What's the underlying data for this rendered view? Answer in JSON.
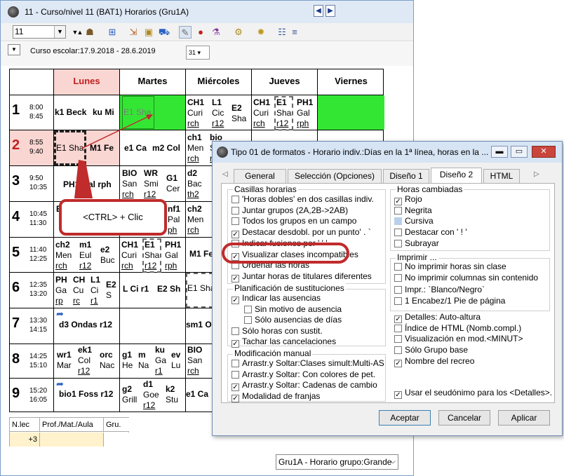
{
  "window": {
    "title": "11 - Curso/nivel 11 (BAT1)  Horarios (Gru1A)",
    "class_selector": "11",
    "school_year": "Curso escolar:17.9.2018 - 28.6.2019",
    "calendar_icon_label": "31"
  },
  "toolbar_icons": [
    "down-arrow-icon",
    "up-arrow-icon",
    "people-icon",
    "plus-grid-icon",
    "export-icon",
    "lock-icon",
    "car-icon",
    "pencil-icon",
    "pin-icon",
    "flask-icon",
    "settings-icon",
    "gear-icon",
    "people-icon",
    "list-menu-icon"
  ],
  "days": [
    "Lunes",
    "Martes",
    "Miércoles",
    "Jueves",
    "Viernes"
  ],
  "periods": [
    {
      "num": "1",
      "start": "8:00",
      "end": "8:45"
    },
    {
      "num": "2",
      "start": "8:55",
      "end": "9:40"
    },
    {
      "num": "3",
      "start": "9:50",
      "end": "10:35"
    },
    {
      "num": "4",
      "start": "10:45",
      "end": "11:30"
    },
    {
      "num": "5",
      "start": "11:40",
      "end": "12:25"
    },
    {
      "num": "6",
      "start": "12:35",
      "end": "13:20"
    },
    {
      "num": "7",
      "start": "13:30",
      "end": "14:15"
    },
    {
      "num": "8",
      "start": "14:25",
      "end": "15:10"
    },
    {
      "num": "9",
      "start": "15:20",
      "end": "16:05"
    }
  ],
  "cells": {
    "p1_lunes_a": "k1 Beck",
    "p1_lunes_b": "ku Mi",
    "p1_martes": "E1 Sha",
    "p1_mie_a": [
      "CH1",
      "Curi",
      "rch"
    ],
    "p1_mie_b": [
      "L1",
      "Cic",
      "r12"
    ],
    "p1_mie_c": [
      "E2",
      "Sha"
    ],
    "p1_jue_a": [
      "CH1",
      "Curi",
      "rch"
    ],
    "p1_jue_b": [
      "E1",
      "Sha",
      "r12"
    ],
    "p1_jue_c": [
      "PH1",
      "Gal",
      "rph"
    ],
    "p2_lunes_a": "E1 Sha",
    "p2_lunes_b": "M1 Fe",
    "p2_martes_a": "e1 Ca",
    "p2_martes_b": "m2 Col",
    "p2_mie_a": [
      "ch1",
      "Men",
      "rch"
    ],
    "p2_mie_b": [
      "bio",
      "S",
      "r"
    ],
    "p3_lunes": "PH1 Gal rph",
    "p3_martes_a": [
      "BIO",
      "San",
      "rch"
    ],
    "p3_martes_b": [
      "WR",
      "Smi",
      "r12"
    ],
    "p3_martes_c": [
      "G1",
      "Cer"
    ],
    "p3_mie_a": [
      "d2",
      "Bac",
      "th2"
    ],
    "p4_lunes": [
      "E"
    ],
    "p4_martes_a": [
      "nf1",
      "Pal",
      "ph"
    ],
    "p4_mie_a": [
      "ch2",
      "Men",
      "rch"
    ],
    "p5_lunes_a": [
      "ch2",
      "Men",
      "rch"
    ],
    "p5_lunes_b": [
      "m1",
      "Eul",
      "r12"
    ],
    "p5_lunes_c": [
      "e2",
      "Buc"
    ],
    "p5_martes_a": [
      "CH1",
      "Curi",
      "rch"
    ],
    "p5_martes_b": [
      "E1",
      "Sha",
      "r12"
    ],
    "p5_martes_c": [
      "PH1",
      "Gal",
      "rph"
    ],
    "p5_mie": "M1 Fe",
    "p6_lunes_a": [
      "PH",
      "Ga",
      "rp"
    ],
    "p6_lunes_b": [
      "CH",
      "Cu",
      "rc"
    ],
    "p6_lunes_c": [
      "L1",
      "Ci",
      "r1"
    ],
    "p6_lunes_d": [
      "E2",
      "S"
    ],
    "p6_martes_a": "L Ci r1",
    "p6_martes_b": "E2 Sh",
    "p6_mie": "E1 Sha",
    "p7_lunes": "d3 Ondas r12",
    "p7_mie": "sm1 O",
    "p8_lunes_a": [
      "wr1",
      "Mar"
    ],
    "p8_lunes_b": [
      "ek1",
      "Col",
      "r12"
    ],
    "p8_lunes_c": [
      "orc",
      "Nac"
    ],
    "p8_martes_a": [
      "g1",
      "He"
    ],
    "p8_martes_b": [
      "m",
      "Na"
    ],
    "p8_martes_c": [
      "ku",
      "Ga",
      "r1"
    ],
    "p8_martes_d": [
      "ev",
      "Lu"
    ],
    "p8_mie": [
      "BIO",
      "San",
      "rch"
    ],
    "p9_lunes": "bio1 Foss r12",
    "p9_martes_a": [
      "g2",
      "Grill"
    ],
    "p9_martes_b": [
      "d1",
      "Goe",
      "r12"
    ],
    "p9_martes_c": [
      "k2",
      "Stu"
    ],
    "p9_mie": "e1 Ca"
  },
  "bottom_panel": {
    "headers": [
      "N.lec",
      "Prof./Mat./Aula",
      "Gru."
    ],
    "row": [
      "+3",
      "",
      ""
    ]
  },
  "group_selector": "Gru1A - Horario grupo:Grande",
  "callout": "<CTRL> + Clic",
  "dialog": {
    "title": "Tipo 01 de formatos - Horario indiv.:Días en la 1ª línea, horas en la ...",
    "tabs": [
      "General",
      "Selección (Opciones)",
      "Diseño 1",
      "Diseño 2",
      "HTML"
    ],
    "active_tab": "Diseño 2",
    "casillas": {
      "label": "Casillas horarias",
      "items": [
        {
          "label": "'Horas dobles' en dos casillas indiv.",
          "checked": false
        },
        {
          "label": "Juntar grupos (2A,2B->2AB)",
          "checked": false
        },
        {
          "label": "Todos los grupos en un campo",
          "checked": false
        },
        {
          "label": "Destacar desdobl. por un punto' . `",
          "checked": true
        },
        {
          "label": "Indicar fusiones por  ' ' '",
          "checked": false
        },
        {
          "label": "Visualizar clases incompatibles",
          "checked": true
        },
        {
          "label": "Ordenar las horas",
          "checked": false
        },
        {
          "label": "Juntar horas de titulares diferentes",
          "checked": true
        }
      ]
    },
    "planificacion": {
      "label": "Planificación de sustituciones",
      "items": [
        {
          "label": "Indicar las ausencias",
          "checked": true
        },
        {
          "label": "Sin motivo de ausencia",
          "checked": false
        },
        {
          "label": "Sólo ausencias de días",
          "checked": false
        },
        {
          "label": "Sólo horas con sustit.",
          "checked": false
        },
        {
          "label": "Tachar las cancelaciones",
          "checked": true
        }
      ]
    },
    "modificacion": {
      "label": "Modificación manual",
      "items": [
        {
          "label": "Arrastr.y Soltar:Clases simult:Multi-AS",
          "checked": false
        },
        {
          "label": "Arrastr.y Soltar: Con colores de pet.",
          "checked": false
        },
        {
          "label": "Arrastr.y Soltar: Cadenas de cambio",
          "checked": true
        },
        {
          "label": "Modalidad de franjas",
          "checked": true
        }
      ]
    },
    "horas_cambiadas": {
      "label": "Horas cambiadas",
      "items": [
        {
          "label": "Rojo",
          "checked": true
        },
        {
          "label": "Negrita",
          "checked": false
        },
        {
          "label": "Cursiva",
          "checked": false,
          "disabled": true
        },
        {
          "label": "Destacar con ' ! '",
          "checked": false
        },
        {
          "label": "Subrayar",
          "checked": false
        }
      ]
    },
    "imprimir": {
      "label": "Imprimir ...",
      "items": [
        {
          "label": "No imprimir horas sin clase",
          "checked": false
        },
        {
          "label": "No imprimir columnas sin contenido",
          "checked": false
        },
        {
          "label": "Impr.: `Blanco/Negro`",
          "checked": false
        },
        {
          "label": "1 Encabez/1 Pie de página",
          "checked": false
        }
      ]
    },
    "extra": [
      {
        "label": "Detalles: Auto-altura",
        "checked": true
      },
      {
        "label": "Índice de HTML (Nomb.compl.)",
        "checked": false
      },
      {
        "label": "Visualización en mod.<MINUT>",
        "checked": false
      },
      {
        "label": "Sólo Grupo base",
        "checked": false
      },
      {
        "label": "Nombre del recreo",
        "checked": true
      }
    ],
    "seudonimo": {
      "label": "Usar el seudónimo para los <Detalles>.",
      "checked": true
    },
    "buttons": {
      "ok": "Aceptar",
      "cancel": "Cancelar",
      "apply": "Aplicar"
    }
  }
}
